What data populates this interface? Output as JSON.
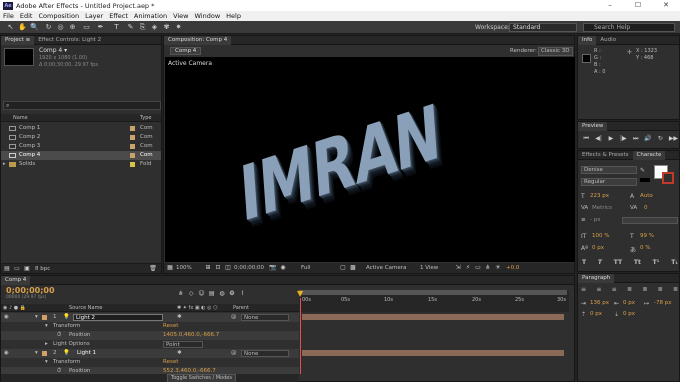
{
  "app": {
    "title": "Adobe After Effects - Untitled Project.aep *",
    "logo_text": "Ae"
  },
  "window_buttons": [
    "–",
    "☐",
    "✕"
  ],
  "menu": [
    "File",
    "Edit",
    "Composition",
    "Layer",
    "Effect",
    "Animation",
    "View",
    "Window",
    "Help"
  ],
  "toolbar": {
    "tools": [
      "selection-tool",
      "hand-tool",
      "zoom-tool",
      "rotation-tool",
      "orbit-camera-tool",
      "pan-behind-tool",
      "rectangle-tool",
      "pen-tool",
      "text-tool",
      "brush-tool",
      "clone-stamp-tool",
      "eraser-tool",
      "roto-brush-tool",
      "puppet-tool"
    ],
    "tool_glyphs": [
      "↖",
      "✋",
      "🔍",
      "↻",
      "◎",
      "⊕",
      "▭",
      "✒",
      "T",
      "✎",
      "⎘",
      "◈",
      "✾",
      "✷"
    ],
    "workspace_label": "Workspace:",
    "workspace_value": "Standard",
    "search_placeholder": "Search Help"
  },
  "project_panel": {
    "tabs": [
      "Project ≡",
      "Effect Controls: Light 2"
    ],
    "comp_name": "Comp 4 ▾",
    "comp_info_1": "1920 x 1080 (1.00)",
    "comp_info_2": "Δ 0;00;30;00, 29.97 fps",
    "search_glyph": "⌕",
    "col_name": "Name",
    "col_type": "Type",
    "items": [
      {
        "name": "Comp 1",
        "type": "Com",
        "color": "#c8a46a",
        "selected": false
      },
      {
        "name": "Comp 2",
        "type": "Com",
        "color": "#c8a46a",
        "selected": false
      },
      {
        "name": "Comp 3",
        "type": "Com",
        "color": "#c8a46a",
        "selected": false
      },
      {
        "name": "Comp 4",
        "type": "Com",
        "color": "#c8a46a",
        "selected": true
      },
      {
        "name": "Solids",
        "type": "Fold",
        "color": "#d8c24a",
        "selected": false
      }
    ],
    "footer_bpc": "8 bpc"
  },
  "comp_panel": {
    "tab": "Composition: Comp 4",
    "sub_tab": "Comp 4",
    "renderer_label": "Renderer:",
    "renderer_value": "Classic 3D",
    "camera_label": "Active Camera",
    "letters": [
      "I",
      "M",
      "R",
      "A",
      "N"
    ],
    "footer": {
      "zoom": "100%",
      "timecode": "0;00;00;00",
      "resolution": "Full",
      "view": "Active Camera",
      "views": "1 View",
      "exposure": "+0.0"
    }
  },
  "info_panel": {
    "tabs": [
      "Info",
      "Audio"
    ],
    "r": "R :",
    "g": "G :",
    "b": "B :",
    "a": "A : 0",
    "x": "X : 1323",
    "y": "Y : 468"
  },
  "preview_panel": {
    "tab": "Preview",
    "controls": [
      "⏮",
      "◀|",
      "▶",
      "|▶",
      "⏭",
      "🔊",
      "↻",
      "▶▶"
    ]
  },
  "character_panel": {
    "tabs": [
      "Effects & Presets",
      "Characte"
    ],
    "font": "Denise",
    "style": "Regular",
    "size": "223 px",
    "leading": "Auto",
    "kerning_label": "Metrics",
    "tracking": "0",
    "stroke": "- px",
    "vscale": "100 %",
    "hscale": "99 %",
    "baseline": "0 px",
    "tsume": "0 %",
    "styles": [
      "T",
      "T",
      "TT",
      "Tt",
      "T¹",
      "T₁"
    ]
  },
  "paragraph_panel": {
    "tab": "Paragraph",
    "indent_left": "136 px",
    "indent_right": "0 px",
    "first_line": "-78 px",
    "space_before": "0 px",
    "space_after": "0 px"
  },
  "timeline": {
    "tab": "Comp 4",
    "timecode": "0;00;00;00",
    "timecode_sub": "00000 (29.97 fps)",
    "col_source": "Source Name",
    "col_parent": "Parent",
    "ruler": [
      "00s",
      "05s",
      "10s",
      "15s",
      "20s",
      "25s",
      "30s"
    ],
    "rows": [
      {
        "indent": 0,
        "num": "1",
        "name": "Light 2",
        "parent": "None",
        "kind": "layer"
      },
      {
        "indent": 1,
        "name": "Transform",
        "value": "Reset",
        "kind": "group"
      },
      {
        "indent": 2,
        "name": "Position",
        "value": "1405.0,460.0,-666.7",
        "kind": "prop"
      },
      {
        "indent": 1,
        "name": "Light Options",
        "value": "Point",
        "kind": "group"
      },
      {
        "indent": 0,
        "num": "2",
        "name": "Light 1",
        "parent": "None",
        "kind": "layer"
      },
      {
        "indent": 1,
        "name": "Transform",
        "value": "Reset",
        "kind": "group"
      },
      {
        "indent": 2,
        "name": "Position",
        "value": "552.3,460.0,-666.7",
        "kind": "prop"
      }
    ],
    "toggle_label": "Toggle Switches / Modes"
  }
}
